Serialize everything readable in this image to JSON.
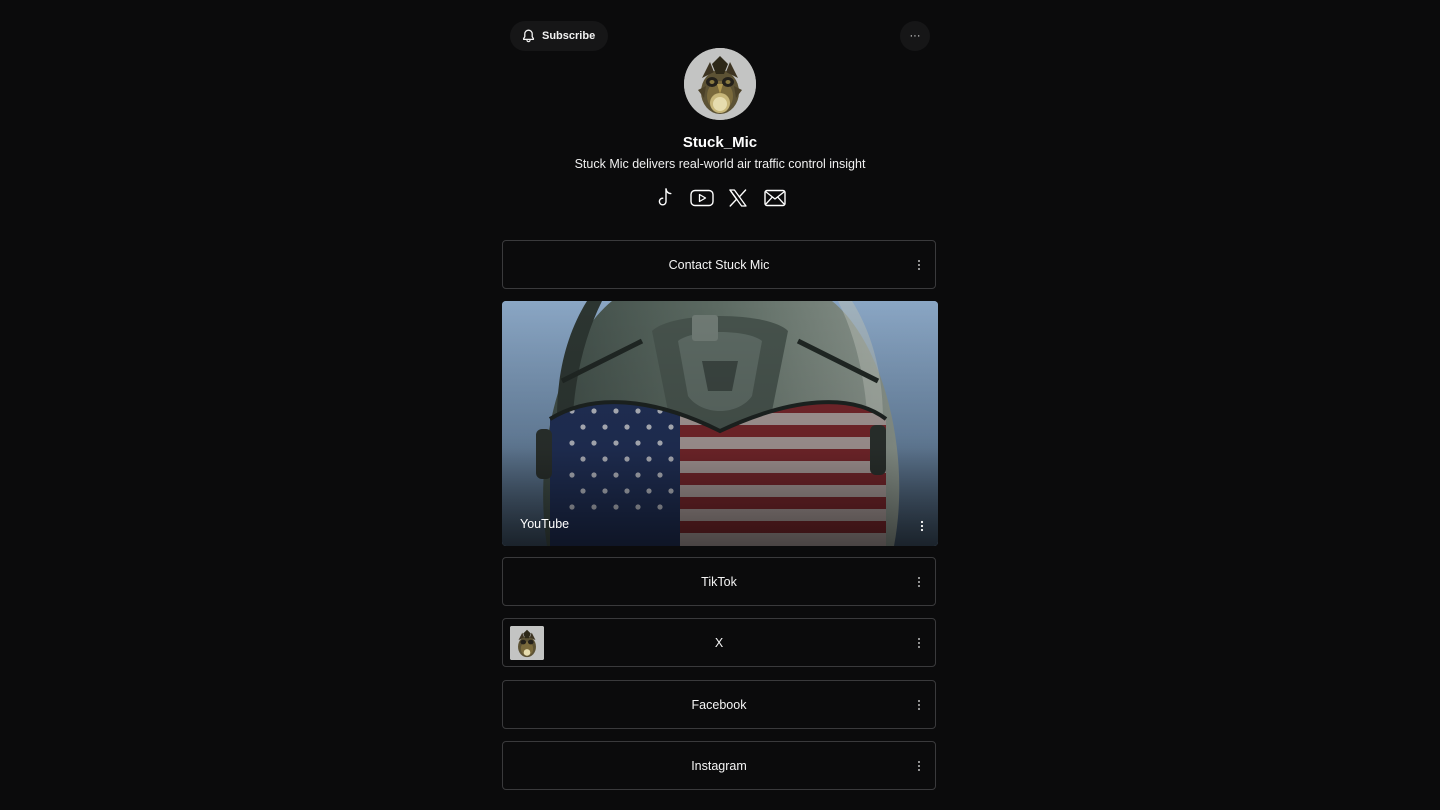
{
  "header": {
    "subscribe_label": "Subscribe",
    "more_label": "···"
  },
  "profile": {
    "name": "Stuck_Mic",
    "bio": "Stuck Mic delivers real-world air traffic control insight"
  },
  "social_icons": [
    "tiktok-icon",
    "youtube-icon",
    "x-icon",
    "email-icon"
  ],
  "links": [
    {
      "label": "Contact Stuck Mic",
      "type": "button"
    },
    {
      "label": "YouTube",
      "type": "featured"
    },
    {
      "label": "TikTok",
      "type": "button"
    },
    {
      "label": "X",
      "type": "button-with-thumbnail"
    },
    {
      "label": "Facebook",
      "type": "button"
    },
    {
      "label": "Instagram",
      "type": "button"
    }
  ],
  "colors": {
    "background": "#0b0b0c",
    "card_border": "#3a3a3c",
    "text": "#ffffff"
  }
}
